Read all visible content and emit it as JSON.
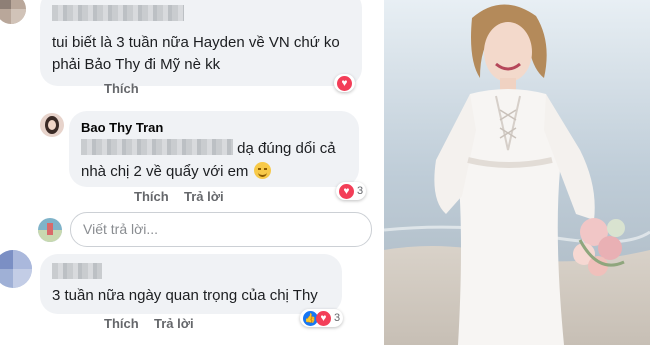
{
  "comments": [
    {
      "text_line1": "tui biết là 3 tuần nữa Hayden về VN chứ ko",
      "text_line2": "phải Bảo Thy đi Mỹ nè kk",
      "like_label": "Thích",
      "reaction": "heart"
    },
    {
      "author": "Bao Thy Tran",
      "text_line1_suffix": "dạ đúng dổi cả",
      "text_line2": "nhà chị 2 về quẩy với em",
      "like_label": "Thích",
      "reply_label": "Trả lời",
      "reaction": "heart",
      "reaction_count": "3"
    },
    {
      "text_line1": "3 tuần nữa ngày quan trọng của chị Thy",
      "like_label": "Thích",
      "reply_label": "Trả lời",
      "reactions": [
        "like",
        "heart"
      ],
      "reaction_count": "3"
    }
  ],
  "reply_input": {
    "placeholder": "Viết trả lời..."
  },
  "photo": {
    "description_icon": "bride-photo"
  },
  "colors": {
    "bubble": "#f0f2f5",
    "heart": "#f33e58",
    "like": "#1877f2",
    "muted": "#65676b"
  }
}
